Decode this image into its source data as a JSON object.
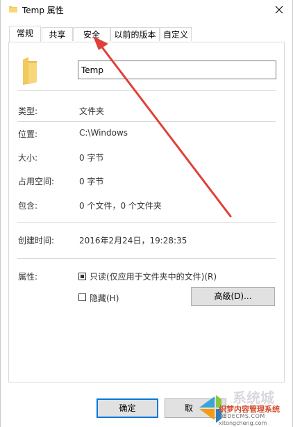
{
  "window": {
    "title": "Temp 属性"
  },
  "tabs": [
    {
      "label": "常规",
      "active": true
    },
    {
      "label": "共享",
      "active": false
    },
    {
      "label": "安全",
      "active": false
    },
    {
      "label": "以前的版本",
      "active": false
    },
    {
      "label": "自定义",
      "active": false
    }
  ],
  "general": {
    "folder_name": "Temp",
    "type_label": "类型:",
    "type_value": "文件夹",
    "location_label": "位置:",
    "location_value": "C:\\Windows",
    "size_label": "大小:",
    "size_value": "0 字节",
    "size_on_disk_label": "占用空间:",
    "size_on_disk_value": "0 字节",
    "contains_label": "包含:",
    "contains_value": "0 个文件，0 个文件夹",
    "created_label": "创建时间:",
    "created_value": "2016年2月24日，19:28:35",
    "attributes_label": "属性:",
    "readonly_label": "只读(仅应用于文件夹中的文件)(R)",
    "readonly_state": "indeterminate",
    "hidden_label": "隐藏(H)",
    "hidden_state": "unchecked",
    "advanced_label": "高级(D)..."
  },
  "footer": {
    "ok_label": "确定",
    "cancel_label": "取"
  },
  "watermark": {
    "line1": "织梦内容管理系统",
    "line2": "DEDECMS.COM",
    "big": "系统城",
    "line3": "xitongcheng.com"
  },
  "colors": {
    "annotation_arrow": "#e0403a",
    "accent": "#0078d7",
    "folder": "#f2c95c"
  }
}
